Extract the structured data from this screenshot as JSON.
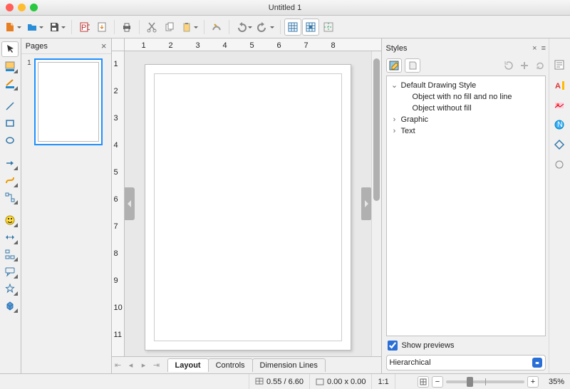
{
  "window": {
    "title": "Untitled 1"
  },
  "toolbar": {
    "items": [
      {
        "name": "new",
        "drop": true,
        "color": "#e67e22"
      },
      {
        "name": "open",
        "drop": true,
        "color": "#2a8dd6"
      },
      {
        "name": "save",
        "drop": true
      },
      {
        "sep": true
      },
      {
        "name": "export-pdf"
      },
      {
        "name": "export"
      },
      {
        "sep": true
      },
      {
        "name": "print"
      },
      {
        "sep": true
      },
      {
        "name": "cut"
      },
      {
        "name": "copy"
      },
      {
        "name": "paste",
        "drop": true
      },
      {
        "sep": true
      },
      {
        "name": "clone"
      },
      {
        "sep": true
      },
      {
        "name": "undo",
        "drop": true
      },
      {
        "name": "redo",
        "drop": true
      },
      {
        "sep": true
      },
      {
        "name": "grid",
        "active": true
      },
      {
        "name": "snap",
        "active": true
      },
      {
        "name": "helplines"
      }
    ]
  },
  "tools": [
    {
      "name": "select",
      "sel": true
    },
    {
      "name": "fill-color",
      "drop": true
    },
    {
      "name": "line-color",
      "drop": true
    },
    {
      "spacer": true
    },
    {
      "name": "line"
    },
    {
      "name": "rect"
    },
    {
      "name": "ellipse"
    },
    {
      "spacer": true
    },
    {
      "name": "arrow",
      "drop": true
    },
    {
      "name": "curve",
      "drop": true
    },
    {
      "name": "connector",
      "drop": true
    },
    {
      "spacer": true
    },
    {
      "name": "smiley",
      "drop": true
    },
    {
      "name": "double-arrow",
      "drop": true
    },
    {
      "name": "flowchart",
      "drop": true
    },
    {
      "name": "callout",
      "drop": true
    },
    {
      "name": "star",
      "drop": true
    },
    {
      "name": "3d",
      "drop": true
    }
  ],
  "pages": {
    "title": "Pages",
    "items": [
      {
        "index": "1"
      }
    ]
  },
  "ruler_h": [
    "1",
    "2",
    "3",
    "4",
    "5",
    "6",
    "7",
    "8"
  ],
  "ruler_v": [
    "1",
    "2",
    "3",
    "4",
    "5",
    "6",
    "7",
    "8",
    "9",
    "10",
    "11"
  ],
  "canvas_tabs": {
    "items": [
      {
        "label": "Layout",
        "active": true
      },
      {
        "label": "Controls"
      },
      {
        "label": "Dimension Lines"
      }
    ]
  },
  "styles": {
    "title": "Styles",
    "subactions": {
      "left": [
        "fill-style",
        "clear-style"
      ],
      "right": [
        "update-style",
        "new-style",
        "refresh"
      ]
    },
    "tree": [
      {
        "label": "Default Drawing Style",
        "expanded": true,
        "children": [
          {
            "label": "Object with no fill and no line"
          },
          {
            "label": "Object without fill"
          }
        ]
      },
      {
        "label": "Graphic",
        "expanded": false
      },
      {
        "label": "Text",
        "expanded": false
      }
    ],
    "show_previews": {
      "label": "Show previews",
      "checked": true
    },
    "mode": "Hierarchical"
  },
  "sidebar_icons": [
    "properties",
    "gallery",
    "navigator",
    "styles-panel",
    "shapes",
    "effects"
  ],
  "status": {
    "page_pos": "0.55 / 6.60",
    "size": "0.00 x 0.00",
    "scale": "1:1",
    "zoom_pct": "35%",
    "zoom_pos": 0.3
  }
}
